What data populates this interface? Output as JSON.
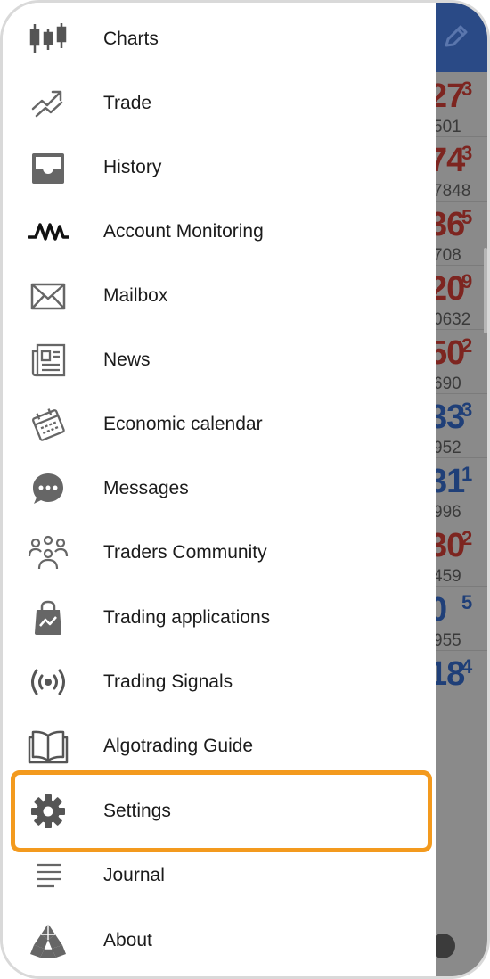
{
  "drawer": {
    "items": [
      {
        "label": "Charts",
        "icon": "candlestick-chart-icon"
      },
      {
        "label": "Trade",
        "icon": "trade-arrow-icon"
      },
      {
        "label": "History",
        "icon": "inbox-tray-icon"
      },
      {
        "label": "Account Monitoring",
        "icon": "pulse-signal-icon"
      },
      {
        "label": "Mailbox",
        "icon": "envelope-icon"
      },
      {
        "label": "News",
        "icon": "newspaper-icon"
      },
      {
        "label": "Economic calendar",
        "icon": "calendar-icon"
      },
      {
        "label": "Messages",
        "icon": "chat-bubble-icon"
      },
      {
        "label": "Traders Community",
        "icon": "community-icon"
      },
      {
        "label": "Trading applications",
        "icon": "shopping-bag-chart-icon"
      },
      {
        "label": "Trading Signals",
        "icon": "broadcast-icon"
      },
      {
        "label": "Algotrading Guide",
        "icon": "open-book-icon"
      },
      {
        "label": "Settings",
        "icon": "gear-icon",
        "highlighted": true
      },
      {
        "label": "Journal",
        "icon": "lines-list-icon"
      },
      {
        "label": "About",
        "icon": "metaquotes-logo-icon"
      }
    ],
    "highlight_color": "#f39a1e"
  },
  "background": {
    "header_color": "#2a4a86",
    "quotes": [
      {
        "big": "27",
        "sup": "3",
        "small": "501",
        "color": "red"
      },
      {
        "big": "74",
        "sup": "3",
        "small": "7848",
        "color": "red"
      },
      {
        "big": "36",
        "sup": "5",
        "small": "708",
        "color": "red"
      },
      {
        "big": "20",
        "sup": "9",
        "small": "0632",
        "color": "red"
      },
      {
        "big": "50",
        "sup": "2",
        "small": "690",
        "color": "red"
      },
      {
        "big": "33",
        "sup": "3",
        "small": "952",
        "color": "blue"
      },
      {
        "big": "31",
        "sup": "1",
        "small": "996",
        "color": "blue"
      },
      {
        "big": "30",
        "sup": "2",
        "small": "459",
        "color": "red"
      },
      {
        "big": "0",
        "sup": "5",
        "small": "955",
        "color": "blue"
      },
      {
        "big": "18",
        "sup": "4",
        "small": "",
        "color": "blue"
      }
    ]
  }
}
